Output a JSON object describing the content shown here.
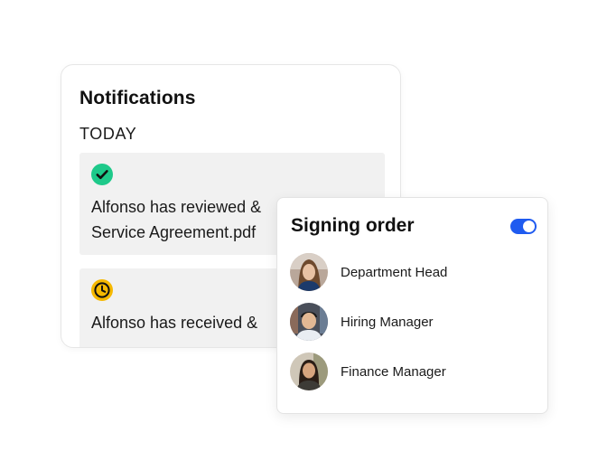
{
  "notifications": {
    "title": "Notifications",
    "section": "TODAY",
    "items": [
      {
        "icon": "check-circle-icon",
        "icon_color": "#1ec98a",
        "line1": "Alfonso has reviewed &",
        "line2": "Service Agreement.pdf"
      },
      {
        "icon": "clock-icon",
        "icon_color": "#f5b800",
        "line1": "Alfonso has received &"
      }
    ]
  },
  "signing_order": {
    "title": "Signing order",
    "toggle_on": true,
    "toggle_color": "#1f5bf0",
    "signers": [
      {
        "name": "Department Head"
      },
      {
        "name": "Hiring Manager"
      },
      {
        "name": "Finance Manager"
      }
    ]
  }
}
